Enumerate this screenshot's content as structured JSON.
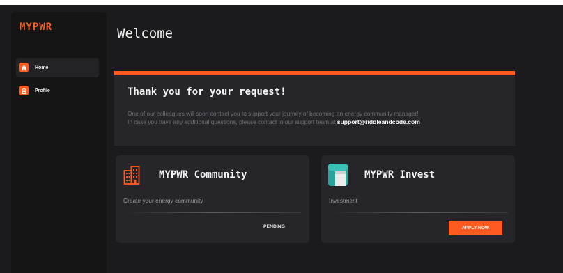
{
  "app": {
    "logo": "MYPWR"
  },
  "sidebar": {
    "items": [
      {
        "label": "Home",
        "icon": "home-icon",
        "active": true
      },
      {
        "label": "Profile",
        "icon": "user-icon",
        "active": false
      }
    ]
  },
  "main": {
    "title": "Welcome",
    "banner": {
      "heading": "Thank you for your request!",
      "line1": "One of our colleagues will soon contact you to support your journey of becoming an energy community manager!",
      "line2_prefix": "In case you have any additional questions, please contact to our support team at",
      "email": "support@riddleandcode.com"
    },
    "cards": [
      {
        "title": "MYPWR Community",
        "description": "Create your energy community",
        "status": "PENDING",
        "icon": "buildings-icon"
      },
      {
        "title": "MYPWR Invest",
        "description": "Investment",
        "button": "APPLY NOW",
        "icon": "invest-icon"
      }
    ]
  },
  "colors": {
    "accent": "#ff5a1f",
    "background": "#1b1b1d",
    "card": "#26262a",
    "sidebar": "#151516",
    "teal": "#2aa39a"
  }
}
